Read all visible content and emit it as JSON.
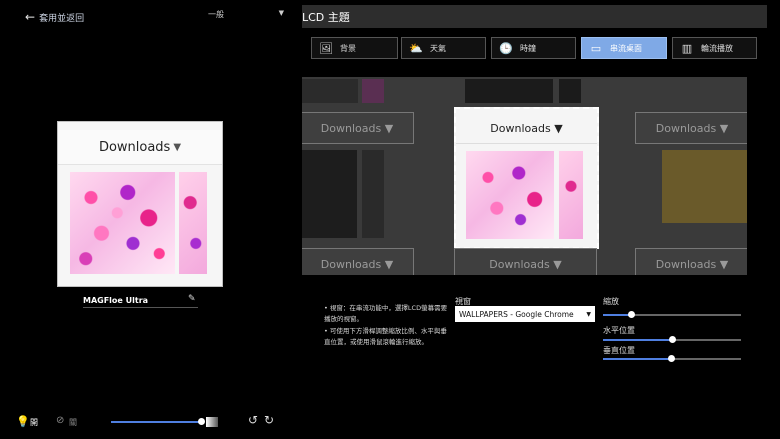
{
  "header": {
    "back_label": "套用並返回",
    "mode_value": "一般"
  },
  "device": {
    "name": "MAGFloe Ultra"
  },
  "preview": {
    "title": "Downloads"
  },
  "light_controls": {
    "on_label": "開",
    "off_label": "關",
    "brightness": 0.9
  },
  "panel": {
    "title": "LCD 主題"
  },
  "tabs": [
    {
      "label": "背景",
      "icon": "image-icon"
    },
    {
      "label": "天氣",
      "icon": "weather-icon"
    },
    {
      "label": "時鐘",
      "icon": "clock-icon"
    },
    {
      "label": "串流桌面",
      "icon": "screen-stream-icon",
      "active": true
    },
    {
      "label": "輪流播放",
      "icon": "slideshow-icon"
    }
  ],
  "carousel": {
    "item_title": "Downloads"
  },
  "notes": [
    "視窗：在串流功能中，選擇LCD螢幕需要播放的視窗。",
    "可使用下方滑桿調整縮放比例、水平與垂直位置，或使用滑鼠滾輪進行縮放。"
  ],
  "window_select": {
    "label": "視窗",
    "value": "WALLPAPERS - Google Chrome"
  },
  "sliders": [
    {
      "label": "縮放",
      "value": 0.2
    },
    {
      "label": "水平位置",
      "value": 0.5
    },
    {
      "label": "垂直位置",
      "value": 0.49
    }
  ],
  "colors": {
    "accent": "#4f7fe0",
    "active_tab": "#7fa9e6"
  }
}
